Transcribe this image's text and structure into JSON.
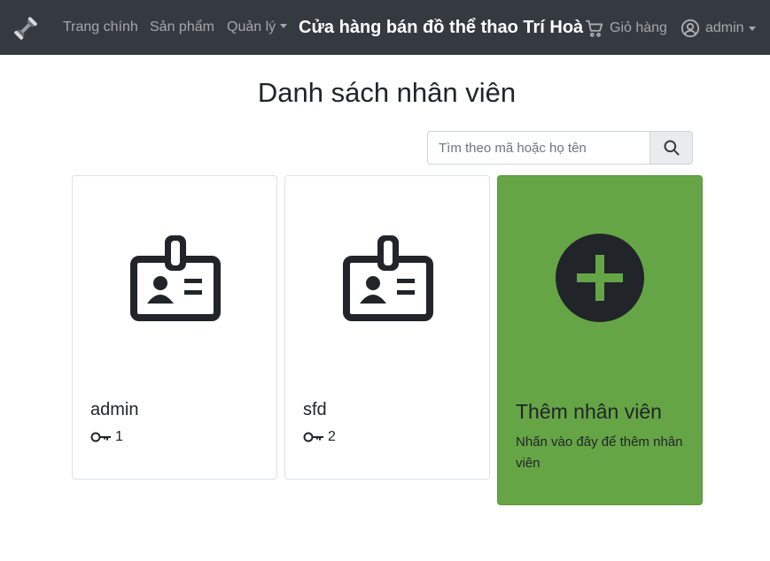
{
  "navbar": {
    "brand_icon": "dumbbell-icon",
    "home": "Trang chính",
    "products": "Sản phẩm",
    "manage": "Quản lý",
    "store_title": "Cửa hàng bán đồ thể thao Trí Hoà",
    "cart": "Giỏ hàng",
    "cart_icon": "cart-icon",
    "user": "admin",
    "user_icon": "user-circle-icon"
  },
  "page": {
    "title": "Danh sách nhân viên"
  },
  "search": {
    "placeholder": "Tìm theo mã hoặc họ tên",
    "value": "",
    "button_icon": "search-icon"
  },
  "employees": [
    {
      "name": "admin",
      "id": "1",
      "icon": "id-badge-icon"
    },
    {
      "name": "sfd",
      "id": "2",
      "icon": "id-badge-icon"
    }
  ],
  "add_card": {
    "title": "Thêm nhân viên",
    "description": "Nhấn vào đây để thêm nhân viên",
    "icon": "plus-circle-icon"
  },
  "colors": {
    "navbar_bg": "#343a40",
    "add_card_bg": "#66a546",
    "icon_dark": "#212529"
  }
}
